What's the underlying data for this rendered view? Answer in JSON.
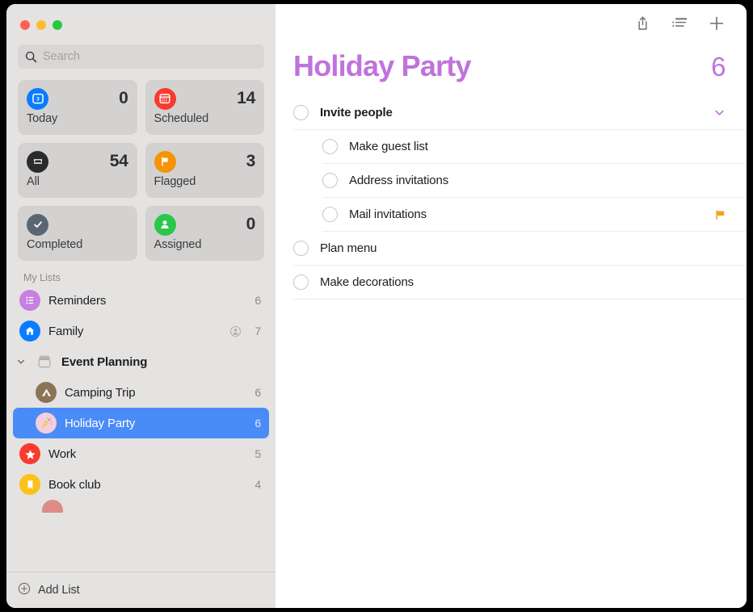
{
  "window": {
    "traffic_lights": [
      "close",
      "minimize",
      "maximize"
    ],
    "accent_color": "#c072dd",
    "selection_color": "#4a8cf7"
  },
  "sidebar": {
    "search": {
      "placeholder": "Search",
      "value": "",
      "icon": "search-icon"
    },
    "smart_cards": [
      {
        "label": "Today",
        "count": "0",
        "icon": "calendar-day-icon",
        "icon_color": "#0a7cff"
      },
      {
        "label": "Scheduled",
        "count": "14",
        "icon": "calendar-icon",
        "icon_color": "#f93a2f"
      },
      {
        "label": "All",
        "count": "54",
        "icon": "inbox-tray-icon",
        "icon_color": "#2b2b2d"
      },
      {
        "label": "Flagged",
        "count": "3",
        "icon": "flag-icon",
        "icon_color": "#f59407"
      },
      {
        "label": "Completed",
        "count": "",
        "icon": "checkmark-icon",
        "icon_color": "#5b6672"
      },
      {
        "label": "Assigned",
        "count": "0",
        "icon": "person-icon",
        "icon_color": "#2ac84a"
      }
    ],
    "section_title": "My Lists",
    "lists": [
      {
        "label": "Reminders",
        "count": "6",
        "icon": "bulleted-list-icon",
        "icon_color": "#c croqueta"
      }
    ],
    "items": [
      {
        "kind": "list",
        "label": "Reminders",
        "count": "6",
        "icon": "bulleted-list-icon",
        "icon_color": "#c77fe0",
        "indent": false,
        "selected": false,
        "shared": false
      },
      {
        "kind": "list",
        "label": "Family",
        "count": "7",
        "icon": "house-icon",
        "icon_color": "#0a7cff",
        "indent": false,
        "selected": false,
        "shared": true
      },
      {
        "kind": "group",
        "label": "Event Planning",
        "count": "",
        "icon": "group-folder-icon",
        "icon_color": "",
        "indent": false,
        "selected": false,
        "shared": false
      },
      {
        "kind": "list",
        "label": "Camping Trip",
        "count": "6",
        "icon": "tent-icon",
        "icon_color": "#8b7355",
        "indent": true,
        "selected": false,
        "shared": false
      },
      {
        "kind": "list",
        "label": "Holiday Party",
        "count": "6",
        "icon": "party-popper-icon",
        "icon_color": "#f3cede",
        "indent": true,
        "selected": true,
        "shared": false
      },
      {
        "kind": "list",
        "label": "Work",
        "count": "5",
        "icon": "star-icon",
        "icon_color": "#f93a2f",
        "indent": false,
        "selected": false,
        "shared": false
      },
      {
        "kind": "list",
        "label": "Book club",
        "count": "4",
        "icon": "bookmark-icon",
        "icon_color": "#fcc219",
        "indent": false,
        "selected": false,
        "shared": false
      }
    ],
    "add_list": {
      "label": "Add List",
      "icon": "plus-circle-icon"
    }
  },
  "toolbar": {
    "buttons": [
      {
        "name": "share-icon",
        "tooltip": "Share"
      },
      {
        "name": "list-view-icon",
        "tooltip": "View options"
      },
      {
        "name": "plus-icon",
        "tooltip": "Add reminder"
      }
    ]
  },
  "main": {
    "title": "Holiday Party",
    "total_count": "6",
    "reminders": [
      {
        "text": "Invite people",
        "sub": false,
        "bold": true,
        "trailing": "chevron-down-icon",
        "completed": false
      },
      {
        "text": "Make guest list",
        "sub": true,
        "bold": false,
        "trailing": "",
        "completed": false
      },
      {
        "text": "Address invitations",
        "sub": true,
        "bold": false,
        "trailing": "",
        "completed": false
      },
      {
        "text": "Mail invitations",
        "sub": true,
        "bold": false,
        "trailing": "flag-icon",
        "completed": false
      },
      {
        "text": "Plan menu",
        "sub": false,
        "bold": false,
        "trailing": "",
        "completed": false
      },
      {
        "text": "Make decorations",
        "sub": false,
        "bold": false,
        "trailing": "",
        "completed": false
      }
    ]
  }
}
